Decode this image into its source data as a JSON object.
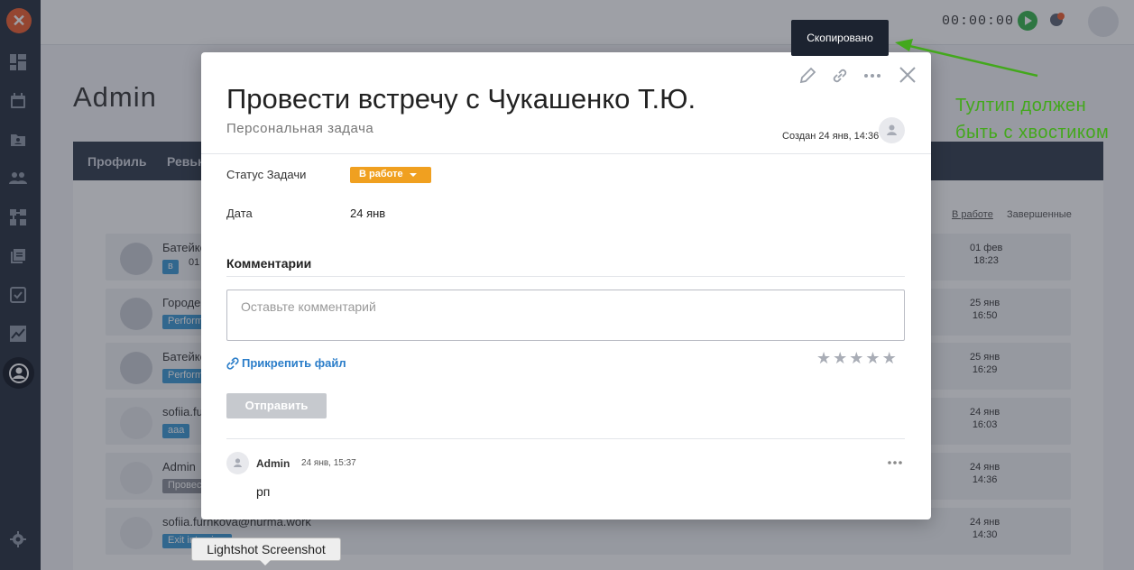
{
  "topbar": {
    "timer": "00:00:00"
  },
  "page": {
    "title": "Admin",
    "tabs": [
      "Профиль",
      "Ревью"
    ],
    "filters": {
      "active": "В работе",
      "other": "Завершенные"
    },
    "rows": [
      {
        "name": "Батейко",
        "tag": "в",
        "tag_extra": "01",
        "date": "01 фев",
        "time": "18:23"
      },
      {
        "name": "Городен",
        "tag": "Perform",
        "date": "25 янв",
        "time": "16:50"
      },
      {
        "name": "Батейко",
        "tag": "Perform",
        "date": "25 янв",
        "time": "16:29"
      },
      {
        "name": "sofiia.fu",
        "tag": "aaa",
        "date": "24 янв",
        "time": "16:03"
      },
      {
        "name": "Admin",
        "tag": "Провес",
        "date": "24 янв",
        "time": "14:36"
      },
      {
        "name": "sofiia.furnkova@nurma.work",
        "tag": "Exit interview",
        "date": "24 янв",
        "time": "14:30"
      }
    ]
  },
  "modal": {
    "title": "Провести встречу с Чукашенко Т.Ю.",
    "subtitle": "Персональная задача",
    "created": "Создан 24 янв, 14:36",
    "status_label": "Статус Задачи",
    "status_value": "В работе",
    "date_label": "Дата",
    "date_value": "24 янв",
    "comments_title": "Комментарии",
    "comment_placeholder": "Оставьте комментарий",
    "attach_label": "Прикрепить файл",
    "send_label": "Отправить",
    "comment": {
      "author": "Admin",
      "time": "24 янв, 15:37",
      "text": "рп"
    }
  },
  "tooltip": {
    "text": "Скопировано"
  },
  "annotation": {
    "line1": "Тултип должен",
    "line2": "быть с хвостиком",
    "color": "#43a81c"
  },
  "lightshot": {
    "label": "Lightshot Screenshot"
  },
  "colors": {
    "sidebar": "#232c3b",
    "status": "#f0a020",
    "accent": "#2a7dc9",
    "logo": "#ef5b2b"
  }
}
